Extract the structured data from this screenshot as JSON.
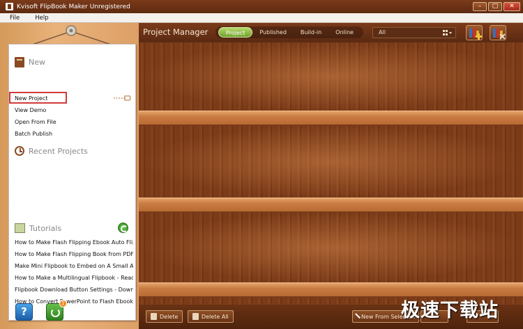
{
  "window": {
    "title": "Kvisoft FlipBook Maker  Unregistered",
    "controls": [
      "–",
      "□",
      "✕"
    ]
  },
  "menubar": {
    "items": [
      "File",
      "Help"
    ]
  },
  "sidebar": {
    "new_section": {
      "heading": "New",
      "items": [
        "New Project",
        "View Demo",
        "Open From File",
        "Batch Publish"
      ]
    },
    "recent_section": {
      "heading": "Recent Projects"
    },
    "tutorials_section": {
      "heading": "Tutorials",
      "items": [
        "How to Make Flash Flipping Ebook Auto Flip?",
        "How to Make Flash Flipping Book from PDF",
        "Make Mini Flipbook to Embed on A Small Area",
        "How to Make a Multilingual Flipbook - Reader Edition",
        "Flipbook Download Button Settings - Download",
        "How to Convert PowerPoint to Flash Ebook Online"
      ]
    },
    "help_label": "?",
    "update_badge": "1"
  },
  "header": {
    "title": "Project Manager",
    "tabs": [
      "Project",
      "Published",
      "Build-in",
      "Online"
    ],
    "active_tab": "Project",
    "filter_value": "All"
  },
  "bottombar": {
    "delete_label": "Delete",
    "delete_all_label": "Delete All",
    "new_from_selected_label": "New From Selected"
  },
  "watermark": "极速下载站",
  "colors": {
    "titlebar": "#6a3014",
    "panel_wood": "#e3a86e",
    "shelf_wood": "#7a3a18",
    "active_tab": "#8ebf45",
    "highlight_box": "#d23a3a"
  }
}
